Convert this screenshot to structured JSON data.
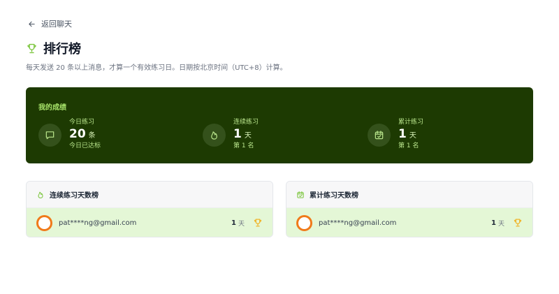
{
  "header": {
    "back_label": "返回聊天",
    "title": "排行榜",
    "subtitle": "每天发送 20 条以上消息，才算一个有效练习日。日期按北京时间（UTC+8）计算。"
  },
  "stats": {
    "heading": "我的成绩",
    "items": [
      {
        "label": "今日练习",
        "value": "20",
        "unit": "条",
        "note": "今日已达标",
        "icon": "chat-icon"
      },
      {
        "label": "连续练习",
        "value": "1",
        "unit": "天",
        "note": "第 1 名",
        "icon": "flame-icon"
      },
      {
        "label": "累计练习",
        "value": "1",
        "unit": "天",
        "note": "第 1 名",
        "icon": "calendar-check-icon"
      }
    ]
  },
  "boards": [
    {
      "title": "连续练习天数榜",
      "icon": "flame-icon",
      "rows": [
        {
          "user": "pat****ng@gmail.com",
          "value": "1",
          "unit": "天",
          "icon": "trophy-icon"
        }
      ]
    },
    {
      "title": "累计练习天数榜",
      "icon": "calendar-check-icon",
      "rows": [
        {
          "user": "pat****ng@gmail.com",
          "value": "1",
          "unit": "天",
          "icon": "trophy-icon"
        }
      ]
    }
  ],
  "colors": {
    "accent": "#8fd14f",
    "stats_background": "#1d3a02",
    "row_highlight": "#e4f7d6",
    "trophy": "#f0b429",
    "avatar_ring": "#f07a1a"
  }
}
